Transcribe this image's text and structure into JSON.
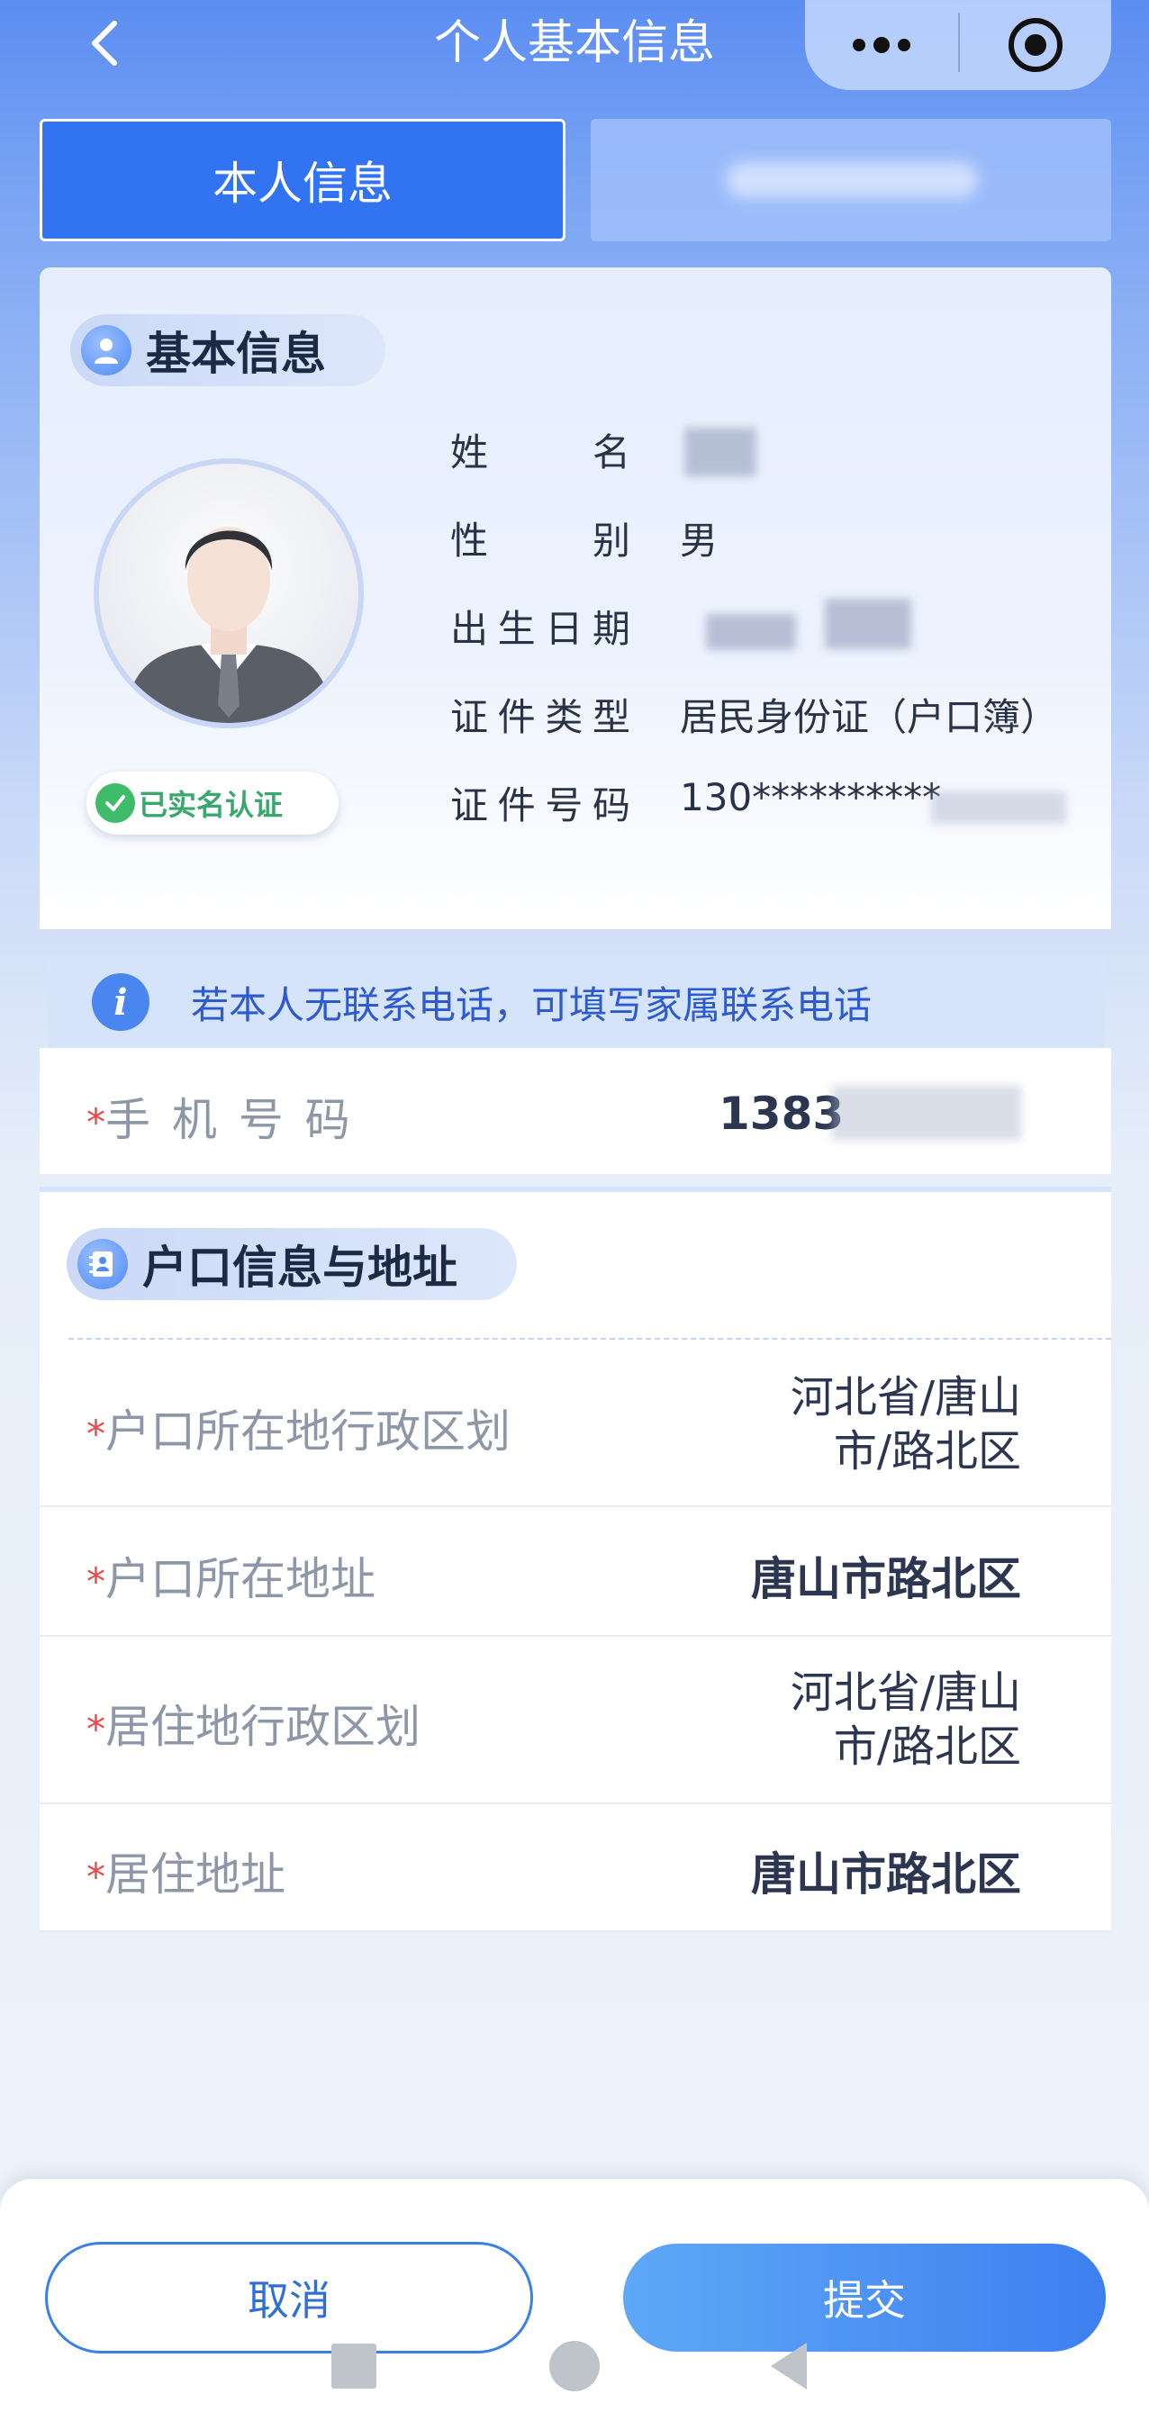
{
  "header": {
    "title": "个人基本信息",
    "back_icon": "chevron-left-icon",
    "more_icon": "more-dots-icon",
    "close_icon": "miniprogram-close-icon"
  },
  "tabs": [
    {
      "label": "本人信息",
      "active": true
    },
    {
      "label": "",
      "active": false
    }
  ],
  "basic_info": {
    "section_title": "基本信息",
    "verified_label": "已实名认证",
    "fields": [
      {
        "label": "姓名",
        "value": ""
      },
      {
        "label": "性别",
        "value": "男"
      },
      {
        "label": "出生日期",
        "value": ""
      },
      {
        "label": "证件类型",
        "value": "居民身份证（户口簿）"
      },
      {
        "label": "证件号码",
        "value": "130**********"
      }
    ]
  },
  "tip": {
    "icon": "info-icon",
    "text": "若本人无联系电话，可填写家属联系电话"
  },
  "phone": {
    "required_mark": "*",
    "label": "手 机 号 码",
    "value": "1383"
  },
  "hukou": {
    "section_title": "户口信息与地址",
    "rows": [
      {
        "label": "户口所在地行政区划",
        "value_line1": "河北省/唐山",
        "value_line2": "市/路北区"
      },
      {
        "label": "户口所在地址",
        "value": "唐山市路北区"
      },
      {
        "label": "居住地行政区划",
        "value_line1": "河北省/唐山",
        "value_line2": "市/路北区"
      },
      {
        "label": "居住地址",
        "value": "唐山市路北区"
      }
    ]
  },
  "actions": {
    "cancel_label": "取消",
    "submit_label": "提交"
  },
  "colors": {
    "primary": "#3273f2",
    "required": "#e44b4b",
    "verified": "#3fbc6a"
  }
}
